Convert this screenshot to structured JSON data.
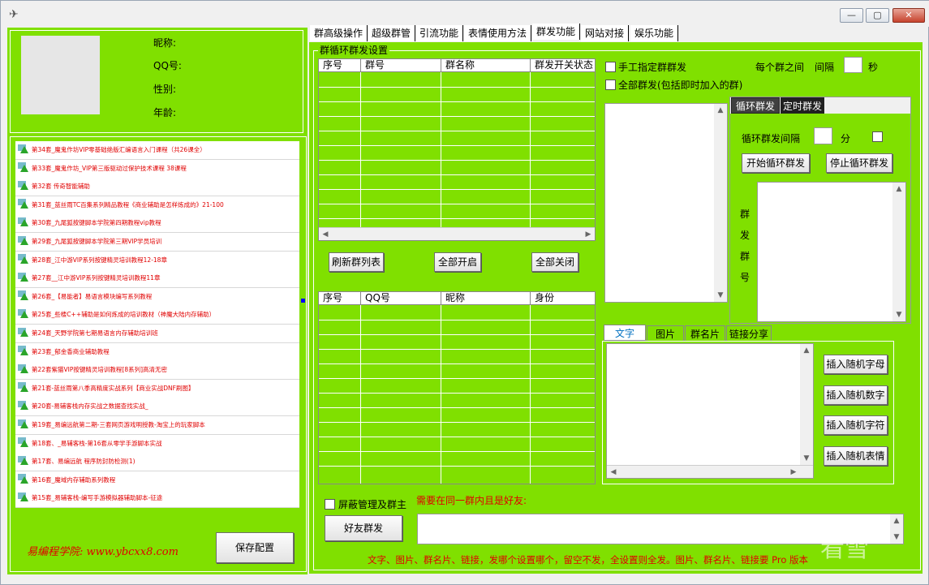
{
  "window": {
    "minimize": "—",
    "maximize": "▢",
    "close": "✕"
  },
  "profile": {
    "nickname": "昵称:",
    "qq": "QQ号:",
    "gender": "性别:",
    "age": "年龄:"
  },
  "courses": [
    "第34套_魔鬼作坊VIP零基础绝版汇编语言入门课程（共26课全）",
    "第33套_魔鬼作坊_VIP第三版驱动过保护技术课程 38课程",
    "第32套 传奇智能辅助",
    "第31套_蓝丝雨TC百集系列精品教程《商业辅助是怎样炼成的》21-100",
    "第30套_九尾狐按键脚本学院第四期教程vip教程",
    "第29套_九尾狐按键脚本学院第三期VIP学员培训",
    "第28套_江中游VIP系列按键精灵培训教程12-18章",
    "第27套__江中游VIP系列按键精灵培训教程11章",
    "第26套_【易能者】易语言模块编写系列教程",
    "第25套_些楼C++辅助是如何炼成的培训教材（神魔大陆内存辅助）",
    "第24套_天野学院第七期易语言内存辅助培训班",
    "第23套_郁金香商业辅助教程",
    "第22套紫猫VIP按键精灵培训教程[8系列]高清无密",
    "第21套-蓝丝雨第八季高精度实战系列【商业实战DNF刷图】",
    "第20套-易辅客栈内存实战之数据查找实战_",
    "第19套_易编远航第二期-三套网页游戏明授教-淘宝上的玩家脚本",
    "第18套、_易辅客栈-第16套从零学手游脚本实战",
    "第17套、易编远航 程序防封防检测(1)",
    "第16套_魔域内存辅助系列教程",
    "第15套_易辅客栈-编写手游模拟器辅助脚本-征途"
  ],
  "footer_left": {
    "school": "易编程学院: www.ybcxx8.com",
    "save": "保存配置"
  },
  "tabs": [
    "群高级操作",
    "超级群管",
    "引流功能",
    "表情使用方法",
    "群发功能",
    "网站对接",
    "娱乐功能"
  ],
  "loop_settings": {
    "group_title": "群循环群发设置",
    "grid1_headers": [
      "序号",
      "群号",
      "群名称",
      "群发开关状态"
    ],
    "refresh": "刷新群列表",
    "all_on": "全部开启",
    "all_off": "全部关闭",
    "grid2_headers": [
      "序号",
      "QQ号",
      "昵称",
      "身份"
    ]
  },
  "options": {
    "manual": "手工指定群群发",
    "all": "全部群发(包括即时加入的群)",
    "interval_prefix": "每个群之间",
    "interval_mid": "间隔",
    "interval_unit": "秒"
  },
  "cycle": {
    "tab1": "循环群发",
    "tab2": "定时群发",
    "interval_label": "循环群发间隔",
    "minute": "分",
    "start": "开始循环群发",
    "stop": "停止循环群发",
    "group_label": "群发群号"
  },
  "content_tabs": [
    "文字",
    "图片",
    "群名片",
    "链接分享"
  ],
  "insert_buttons": [
    "插入随机字母",
    "插入随机数字",
    "插入随机字符",
    "插入随机表情"
  ],
  "bottom": {
    "block_admin": "屏蔽管理及群主",
    "friends_note": "需要在同一群内且是好友:",
    "friend_send": "好友群发",
    "notice": "文字、图片、群名片、链接，发哪个设置哪个，留空不发，全设置则全发。图片、群名片、链接要 Pro 版本"
  },
  "watermark": "看雪"
}
